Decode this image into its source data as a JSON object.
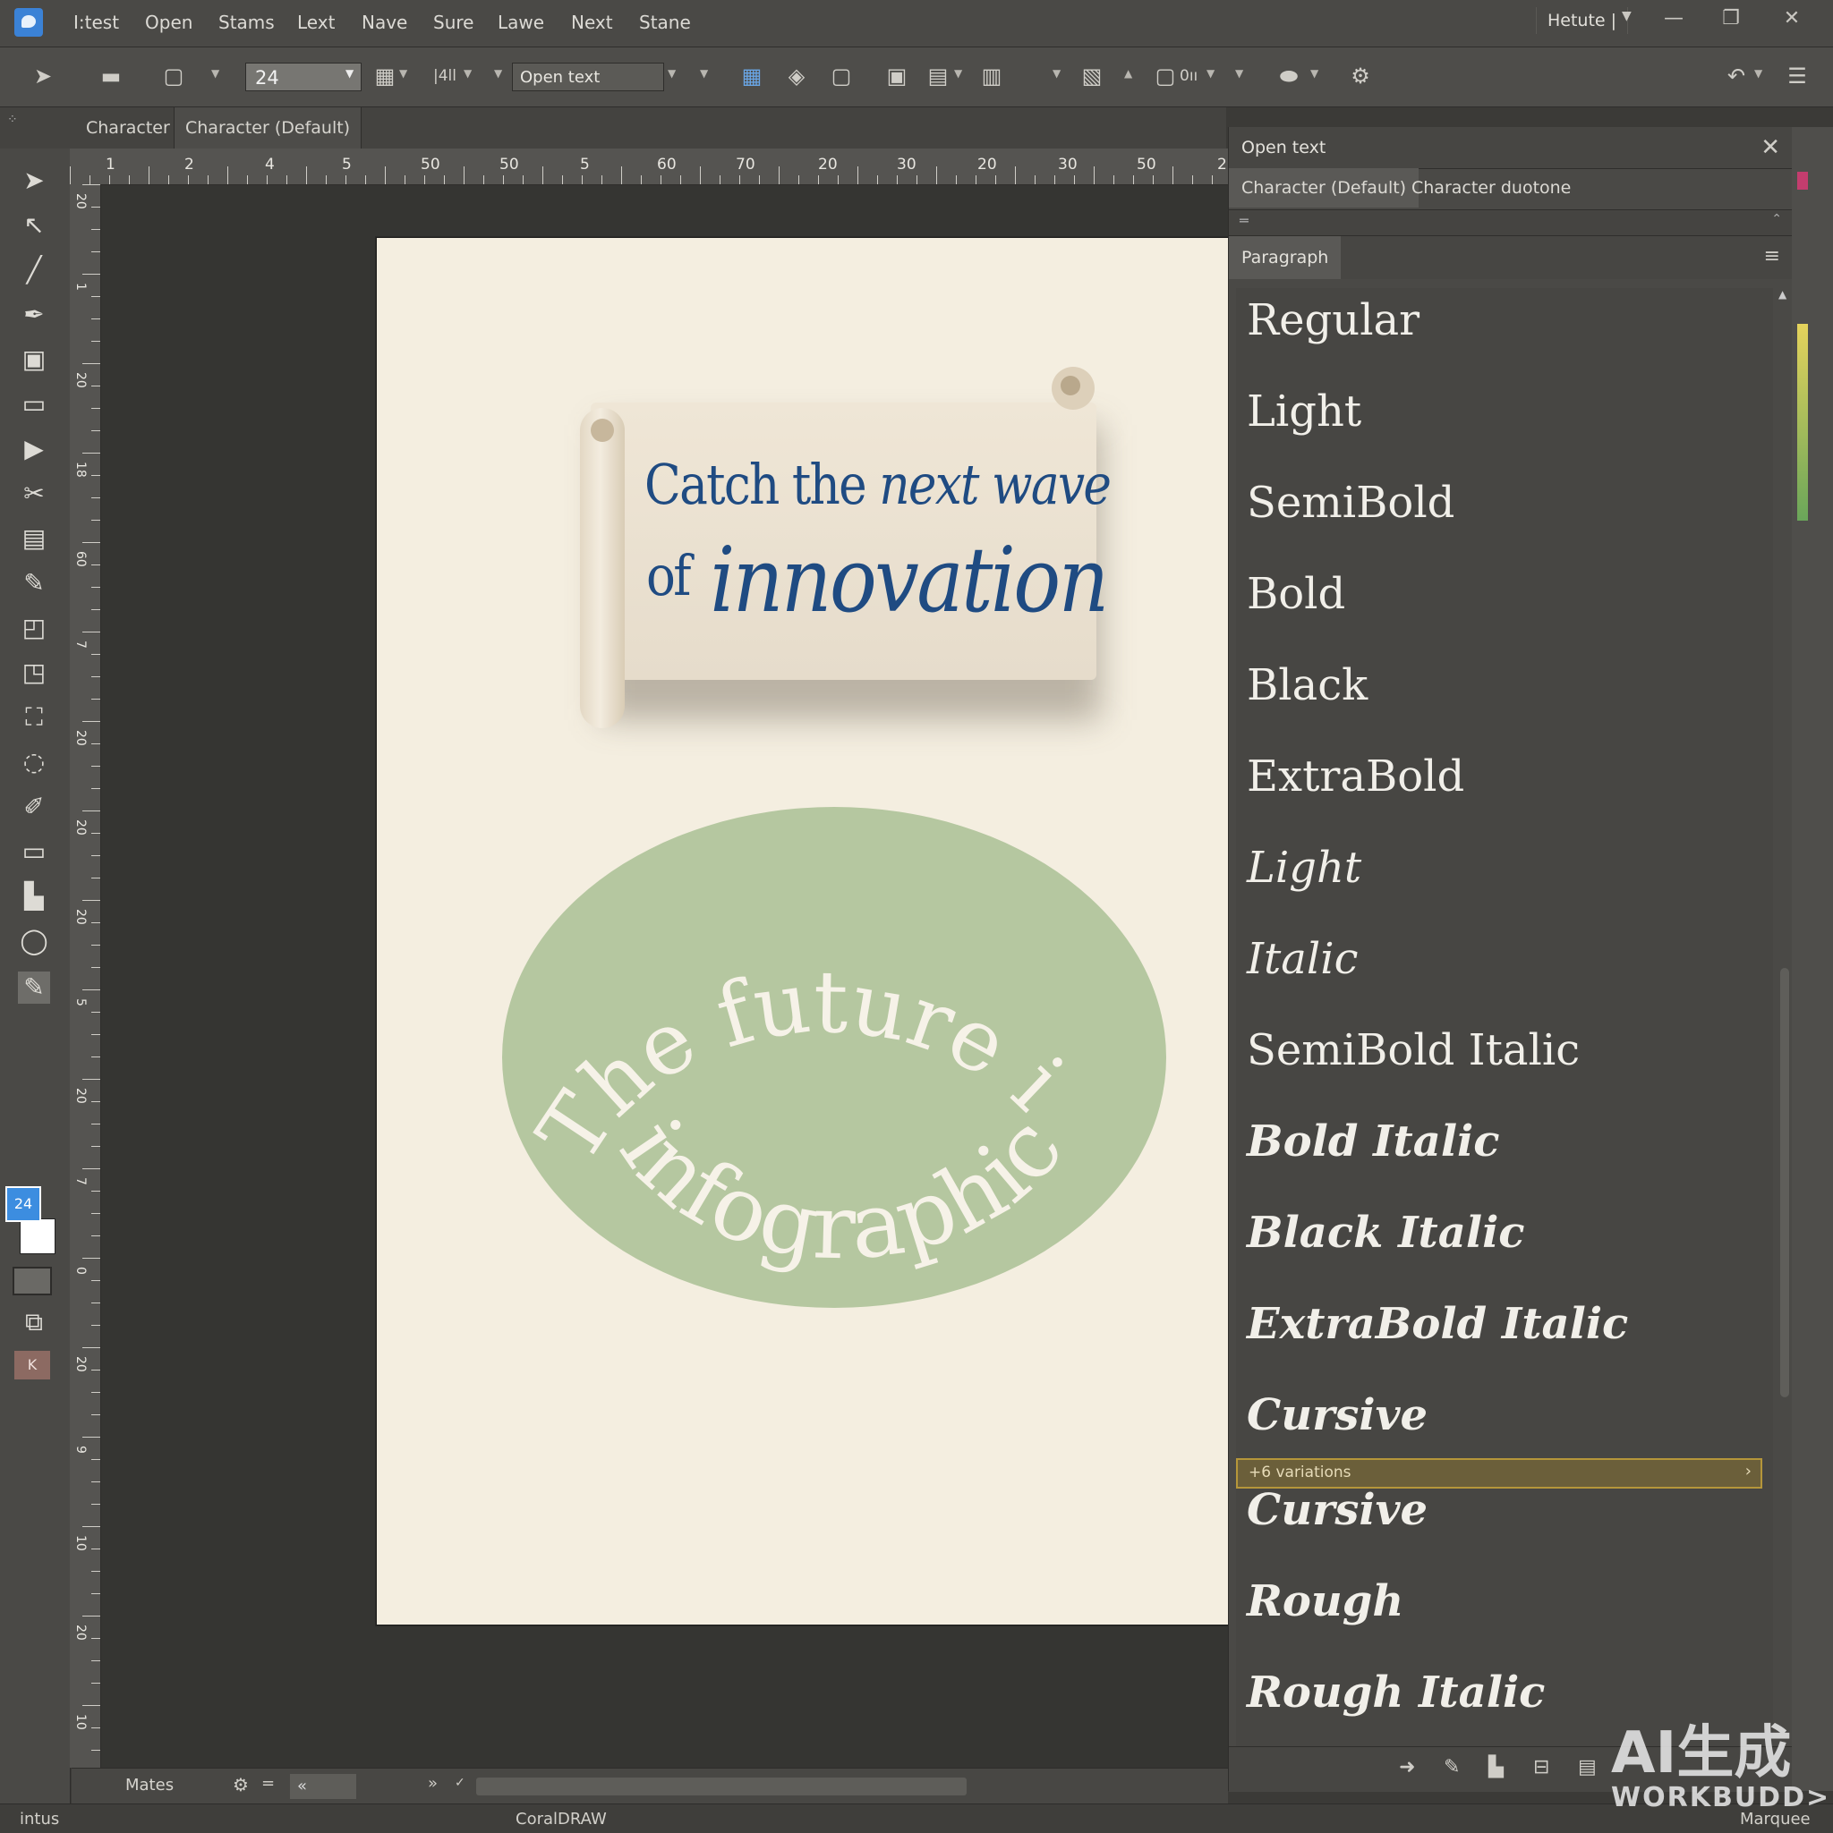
{
  "menubar": {
    "items": [
      "I:test",
      "Open",
      "Stams",
      "Lext",
      "Nave",
      "Sure",
      "Lawe",
      "Next",
      "Stane"
    ],
    "window_title": "Hetute |"
  },
  "toolbar": {
    "font_size": "24",
    "size_mode": "|4ll",
    "font_name": "Open text",
    "size_readout": "0ıı"
  },
  "tabs": [
    "Character",
    "Character (Default)"
  ],
  "ruler": {
    "top": [
      "1",
      "2",
      "4",
      "5",
      "50",
      "50",
      "5",
      "60",
      "70",
      "20",
      "30",
      "20",
      "30",
      "50",
      "2"
    ],
    "left": [
      "20",
      "1",
      "20",
      "18",
      "60",
      "7",
      "20",
      "20",
      "20",
      "5",
      "20",
      "7",
      "0",
      "20",
      "9",
      "10",
      "20",
      "10"
    ]
  },
  "color_swatch_label": "24",
  "artwork": {
    "headline_line1_a": "Catch the ",
    "headline_line1_b": "next wave",
    "headline_line2_a": "of ",
    "headline_line2_b": "innovation",
    "arc_top": "The future is",
    "arc_bottom": "infographic",
    "colors": {
      "headline": "#1f4b82",
      "oval": "#b5c7a0",
      "page": "#f4eee0"
    }
  },
  "docker": {
    "title": "Open text",
    "tabs": [
      "Character (Default)",
      "Character duotone"
    ],
    "section": "Paragraph",
    "styles": [
      {
        "label": "Regular",
        "italic": false,
        "weight": "normal"
      },
      {
        "label": "Light",
        "italic": false,
        "weight": "normal"
      },
      {
        "label": "SemiBold",
        "italic": false,
        "weight": "normal"
      },
      {
        "label": "Bold",
        "italic": false,
        "weight": "normal"
      },
      {
        "label": "Black",
        "italic": false,
        "weight": "normal"
      },
      {
        "label": "ExtraBold",
        "italic": false,
        "weight": "normal"
      },
      {
        "label": "Light",
        "italic": true,
        "weight": "normal"
      },
      {
        "label": "Italic",
        "italic": true,
        "weight": "normal"
      },
      {
        "label": "SemiBold Italic",
        "italic": false,
        "weight": "normal"
      },
      {
        "label": "Bold Italic",
        "italic": true,
        "weight": "bold"
      },
      {
        "label": "Black Italic",
        "italic": true,
        "weight": "bold"
      },
      {
        "label": "ExtraBold Italic",
        "italic": true,
        "weight": "bold"
      },
      {
        "label": "Cursive",
        "italic": true,
        "weight": "bold"
      }
    ],
    "variations_label": "+6 variations",
    "styles_after": [
      {
        "label": "Cursive",
        "italic": true,
        "weight": "bold"
      },
      {
        "label": "Rough",
        "italic": true,
        "weight": "bold"
      },
      {
        "label": "Rough Italic",
        "italic": true,
        "weight": "bold"
      }
    ]
  },
  "pagebar": {
    "label": "Mates"
  },
  "statusbar": {
    "left": "intus",
    "center": "CoralDRAW",
    "right": "Marquee"
  },
  "watermark": {
    "line1": "AI生成",
    "line2": "WORKBUDD>"
  }
}
